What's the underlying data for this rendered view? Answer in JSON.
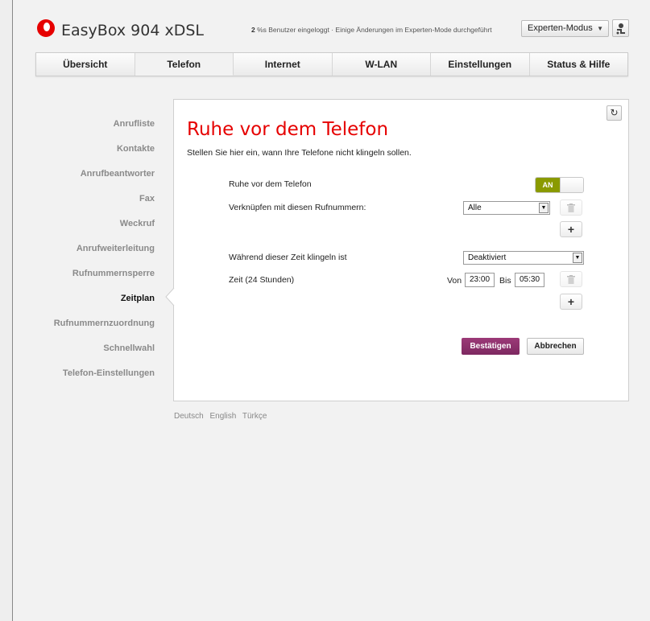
{
  "header": {
    "app_title": "EasyBox 904 xDSL",
    "status_count": "2",
    "status_text": " %s Benutzer eingeloggt · Einige Änderungen im Experten-Mode durchgeführt",
    "mode_select": "Experten-Modus"
  },
  "nav": {
    "tabs": [
      {
        "label": "Übersicht"
      },
      {
        "label": "Telefon"
      },
      {
        "label": "Internet"
      },
      {
        "label": "W-LAN"
      },
      {
        "label": "Einstellungen"
      },
      {
        "label": "Status & Hilfe"
      }
    ],
    "active": "Telefon"
  },
  "sidebar": {
    "items": [
      {
        "label": "Anrufliste"
      },
      {
        "label": "Kontakte"
      },
      {
        "label": "Anrufbeantworter"
      },
      {
        "label": "Fax"
      },
      {
        "label": "Weckruf"
      },
      {
        "label": "Anrufweiterleitung"
      },
      {
        "label": "Rufnummernsperre"
      },
      {
        "label": "Zeitplan"
      },
      {
        "label": "Rufnummernzuordnung"
      },
      {
        "label": "Schnellwahl"
      },
      {
        "label": "Telefon-Einstellungen"
      }
    ],
    "active": "Zeitplan"
  },
  "main": {
    "title": "Ruhe vor dem Telefon",
    "subtitle": "Stellen Sie hier ein, wann Ihre Telefone nicht klingeln sollen.",
    "dnd_label": "Ruhe vor dem Telefon",
    "dnd_toggle": "AN",
    "link_label": "Verknüpfen mit diesen Rufnummern:",
    "link_value": "Alle",
    "ring_label": "Während dieser Zeit klingeln ist",
    "ring_value": "Deaktiviert",
    "time_label": "Zeit (24 Stunden)",
    "from_label": "Von",
    "from_value": "23:00",
    "to_label": "Bis",
    "to_value": "05:30",
    "confirm_label": "Bestätigen",
    "cancel_label": "Abbrechen"
  },
  "footer": {
    "languages": [
      "Deutsch",
      "English",
      "Türkçe"
    ]
  },
  "colors": {
    "brand_red": "#e60000",
    "toggle_on": "#8a9a00",
    "primary_button": "#8a2f6b"
  }
}
